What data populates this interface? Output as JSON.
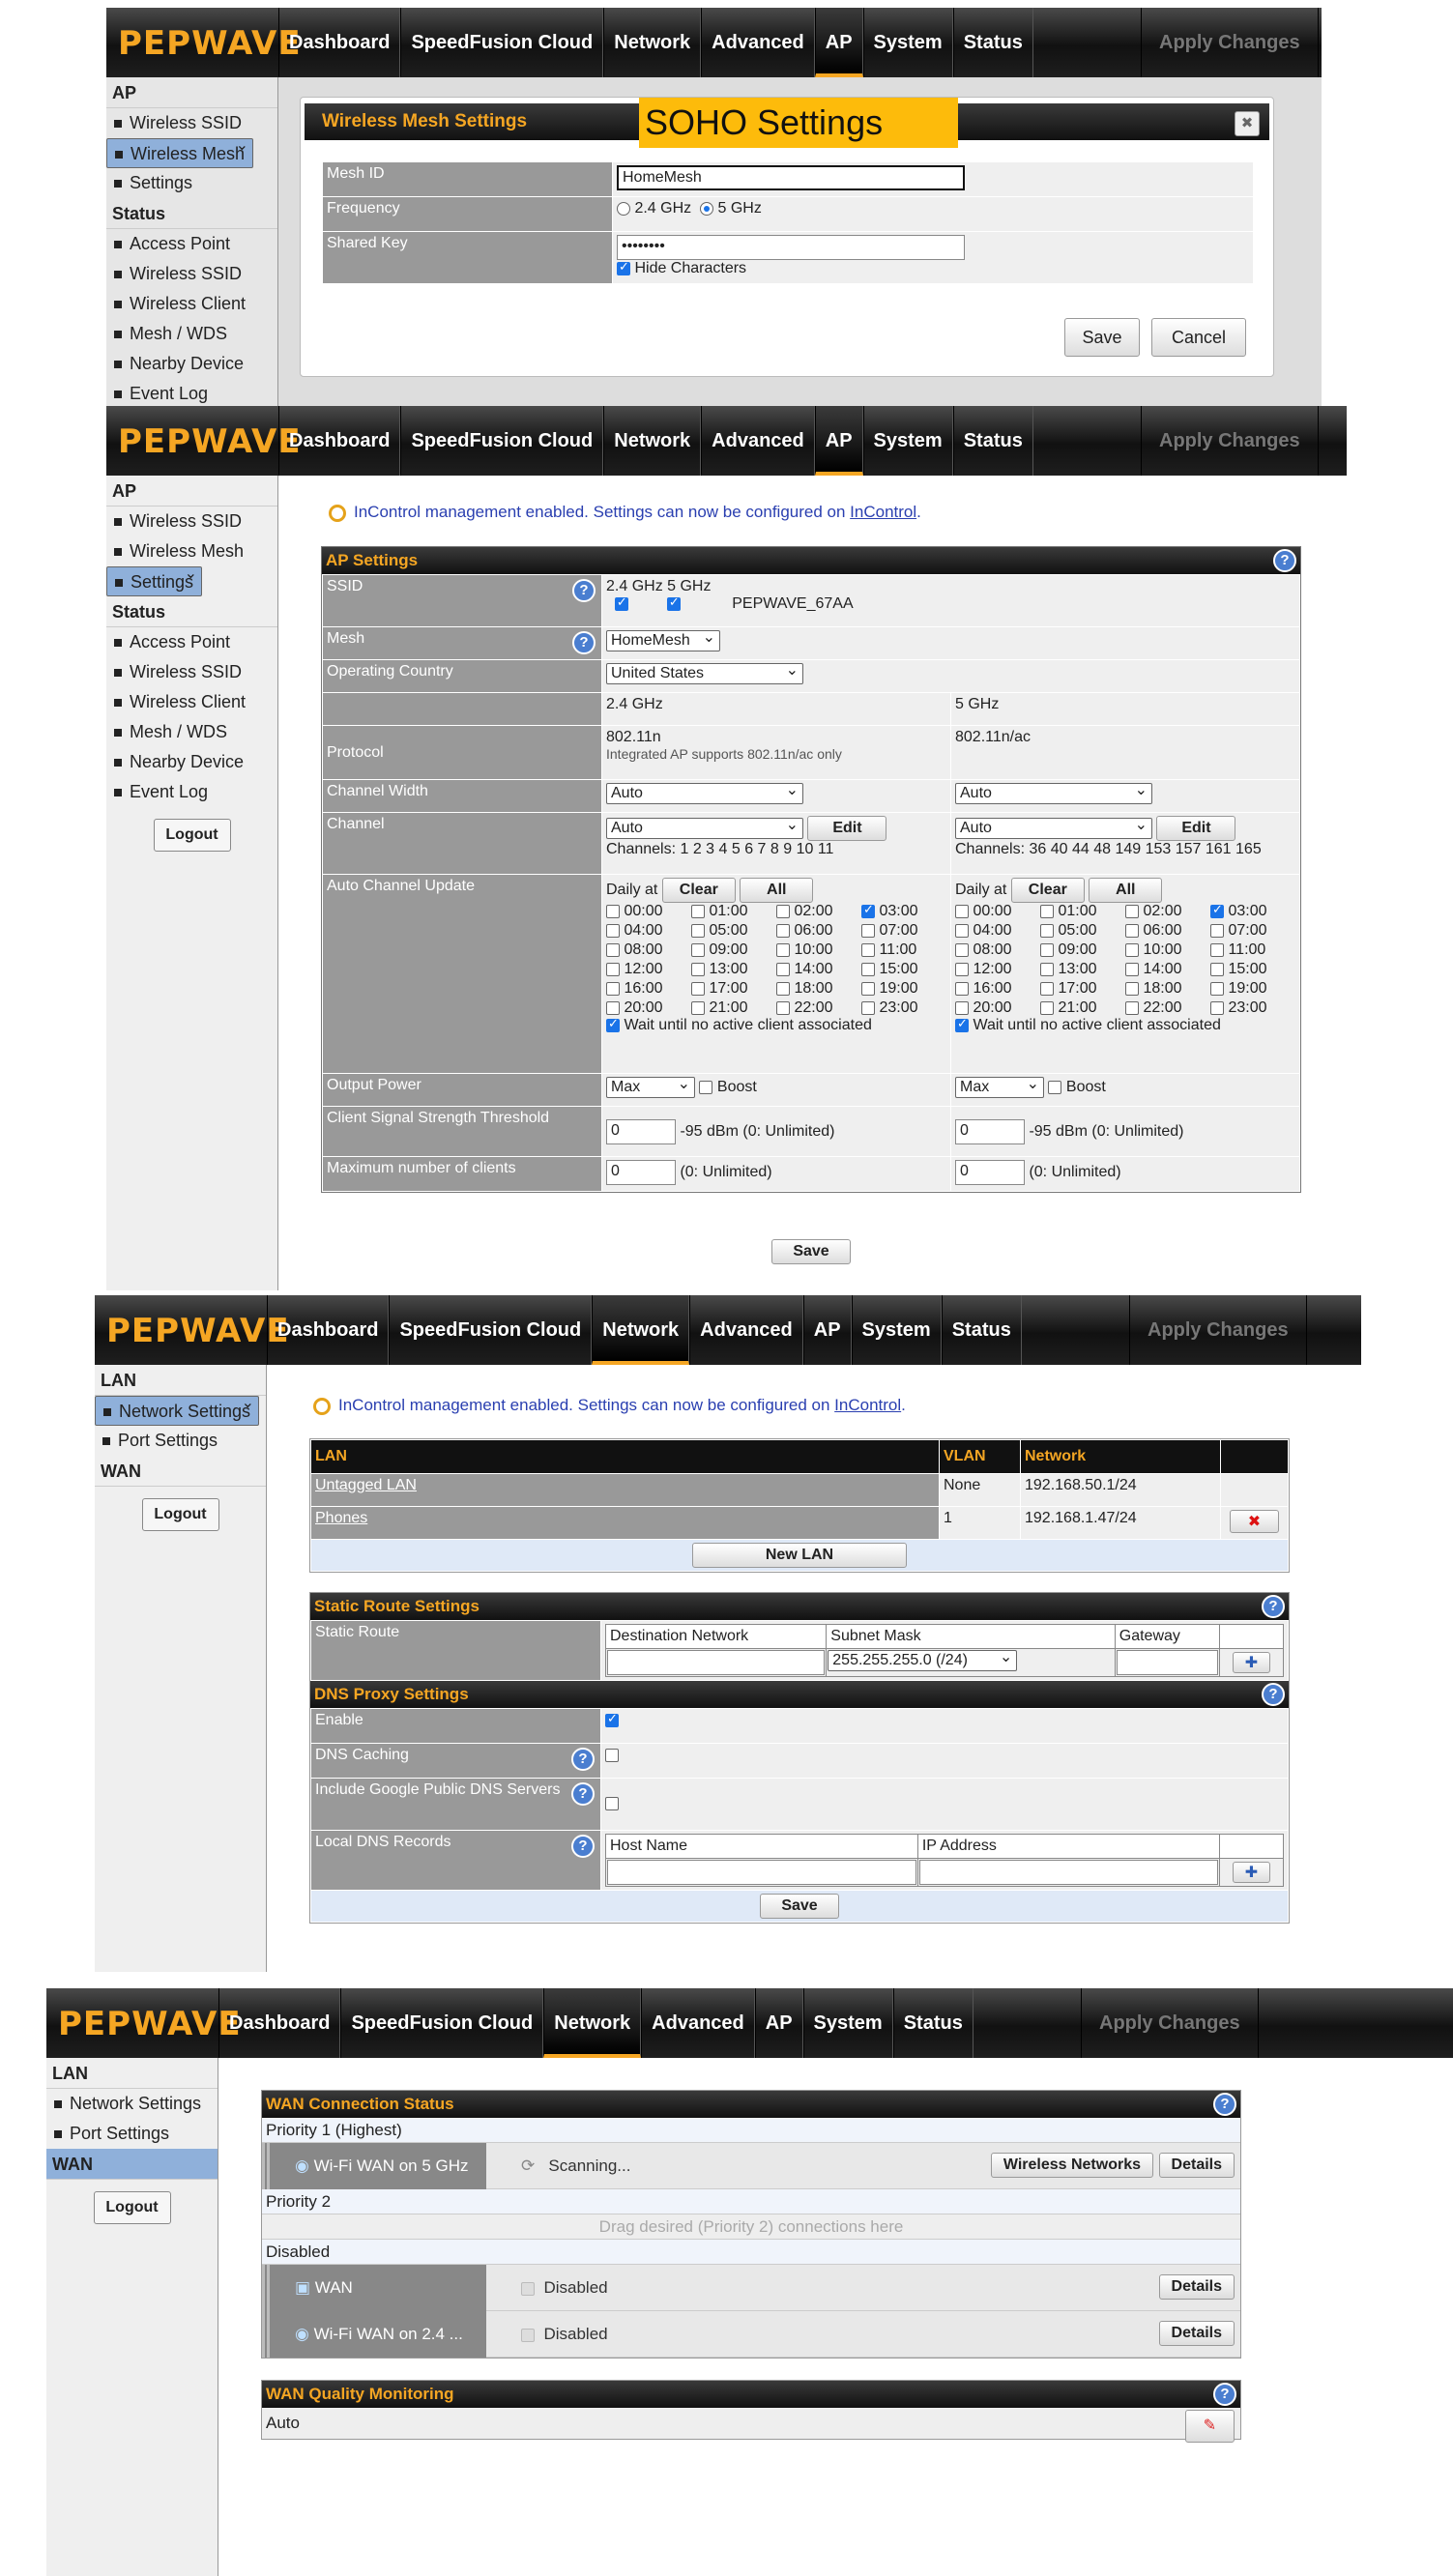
{
  "brand": "PEPWAVE",
  "nav": [
    "Dashboard",
    "SpeedFusion Cloud",
    "Network",
    "Advanced",
    "AP",
    "System",
    "Status"
  ],
  "apply": "Apply Changes",
  "logout": "Logout",
  "apSide": {
    "h1": "AP",
    "items1": [
      "Wireless SSID",
      "Wireless Mesh",
      "Settings"
    ],
    "h2": "Status",
    "items2": [
      "Access Point",
      "Wireless SSID",
      "Wireless Client",
      "Mesh / WDS",
      "Nearby Device",
      "Event Log"
    ]
  },
  "netSide": {
    "h1": "LAN",
    "items1": [
      "Network Settings",
      "Port Settings"
    ],
    "h2": "WAN"
  },
  "info": {
    "pre": "InControl management enabled. Settings can now be configured on ",
    "link": "InControl",
    "post": "."
  },
  "mesh": {
    "title": "Wireless Mesh Settings",
    "banner": "SOHO Settings",
    "id_label": "Mesh ID",
    "id_value": "HomeMesh",
    "freq_label": "Frequency",
    "f24": "2.4 GHz",
    "f5": "5 GHz",
    "key_label": "Shared Key",
    "key_value": "••••••••",
    "hide": "Hide Characters",
    "save": "Save",
    "cancel": "Cancel",
    "close": "✖"
  },
  "ap": {
    "title": "AP Settings",
    "ssid": "SSID",
    "b24": "2.4 GHz",
    "b5": "5 GHz",
    "ssid_name": "PEPWAVE_67AA",
    "mesh": "Mesh",
    "mesh_val": "HomeMesh",
    "country": "Operating Country",
    "country_val": "United States",
    "protocol": "Protocol",
    "p24": "802.11n",
    "p5": "802.11n/ac",
    "integrated": "Integrated AP supports 802.11n/ac only",
    "cw": "Channel Width",
    "auto": "Auto",
    "channel": "Channel",
    "edit": "Edit",
    "ch24": "Channels: 1 2 3 4 5 6 7 8 9 10 11",
    "ch5": "Channels: 36 40 44 48 149 153 157 161 165",
    "acu": "Auto Channel Update",
    "daily": "Daily at",
    "clear": "Clear",
    "all": "All",
    "times": [
      "00:00",
      "01:00",
      "02:00",
      "03:00",
      "04:00",
      "05:00",
      "06:00",
      "07:00",
      "08:00",
      "09:00",
      "10:00",
      "11:00",
      "12:00",
      "13:00",
      "14:00",
      "15:00",
      "16:00",
      "17:00",
      "18:00",
      "19:00",
      "20:00",
      "21:00",
      "22:00",
      "23:00"
    ],
    "wait": "Wait until no active client associated",
    "op": "Output Power",
    "max": "Max",
    "boost": "Boost",
    "css": "Client Signal Strength Threshold",
    "css_val": "0",
    "css_unit": "-95 dBm (0: Unlimited)",
    "maxc": "Maximum number of clients",
    "maxc_val": "0",
    "maxc_unit": "(0: Unlimited)",
    "save": "Save"
  },
  "lan": {
    "hd": "LAN",
    "vlan": "VLAN",
    "network": "Network",
    "rows": [
      {
        "name": "Untagged LAN",
        "vlan": "None",
        "net": "192.168.50.1/24"
      },
      {
        "name": "Phones",
        "vlan": "1",
        "net": "192.168.1.47/24"
      }
    ],
    "newlan": "New LAN",
    "static_title": "Static Route Settings",
    "static": "Static Route",
    "dest": "Destination Network",
    "mask": "Subnet Mask",
    "gw": "Gateway",
    "mask_val": "255.255.255.0 (/24)",
    "dns_title": "DNS Proxy Settings",
    "enable": "Enable",
    "caching": "DNS Caching",
    "google": "Include Google Public DNS Servers",
    "local": "Local DNS Records",
    "host": "Host Name",
    "ip": "IP Address",
    "save": "Save"
  },
  "wan": {
    "title": "WAN Connection Status",
    "p1": "Priority 1 (Highest)",
    "wifi5": "Wi-Fi WAN on 5 GHz",
    "scanning": "Scanning...",
    "wn": "Wireless Networks",
    "details": "Details",
    "p2": "Priority 2",
    "drag": "Drag desired (Priority 2) connections here",
    "disabled_hd": "Disabled",
    "wan": "WAN",
    "disabled": "Disabled",
    "wifi24": "Wi-Fi WAN on 2.4 ...",
    "qm": "WAN Quality Monitoring",
    "qm_val": "Auto"
  }
}
